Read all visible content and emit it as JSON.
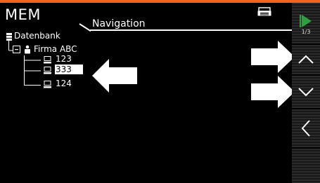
{
  "header": {
    "title": "MEM",
    "subtitle": "Navigation",
    "printer_icon": "printer-icon"
  },
  "tree": {
    "root_label": "Datenbank",
    "customer_label": "Firma ABC",
    "devices": [
      "123",
      "333",
      "124"
    ],
    "selected_device": "333"
  },
  "sidebar": {
    "page_indicator": "1/3",
    "buttons": [
      "play-next-icon",
      "chevron-up-icon",
      "chevron-down-icon",
      "arrow-left-icon"
    ]
  },
  "overlay_arrows": [
    "arrow-pointing-left",
    "arrow-pointing-right",
    "arrow-pointing-right"
  ],
  "colors": {
    "accent": "#f0641e",
    "background": "#000000",
    "play": "#2ea043",
    "foreground": "#ffffff"
  }
}
